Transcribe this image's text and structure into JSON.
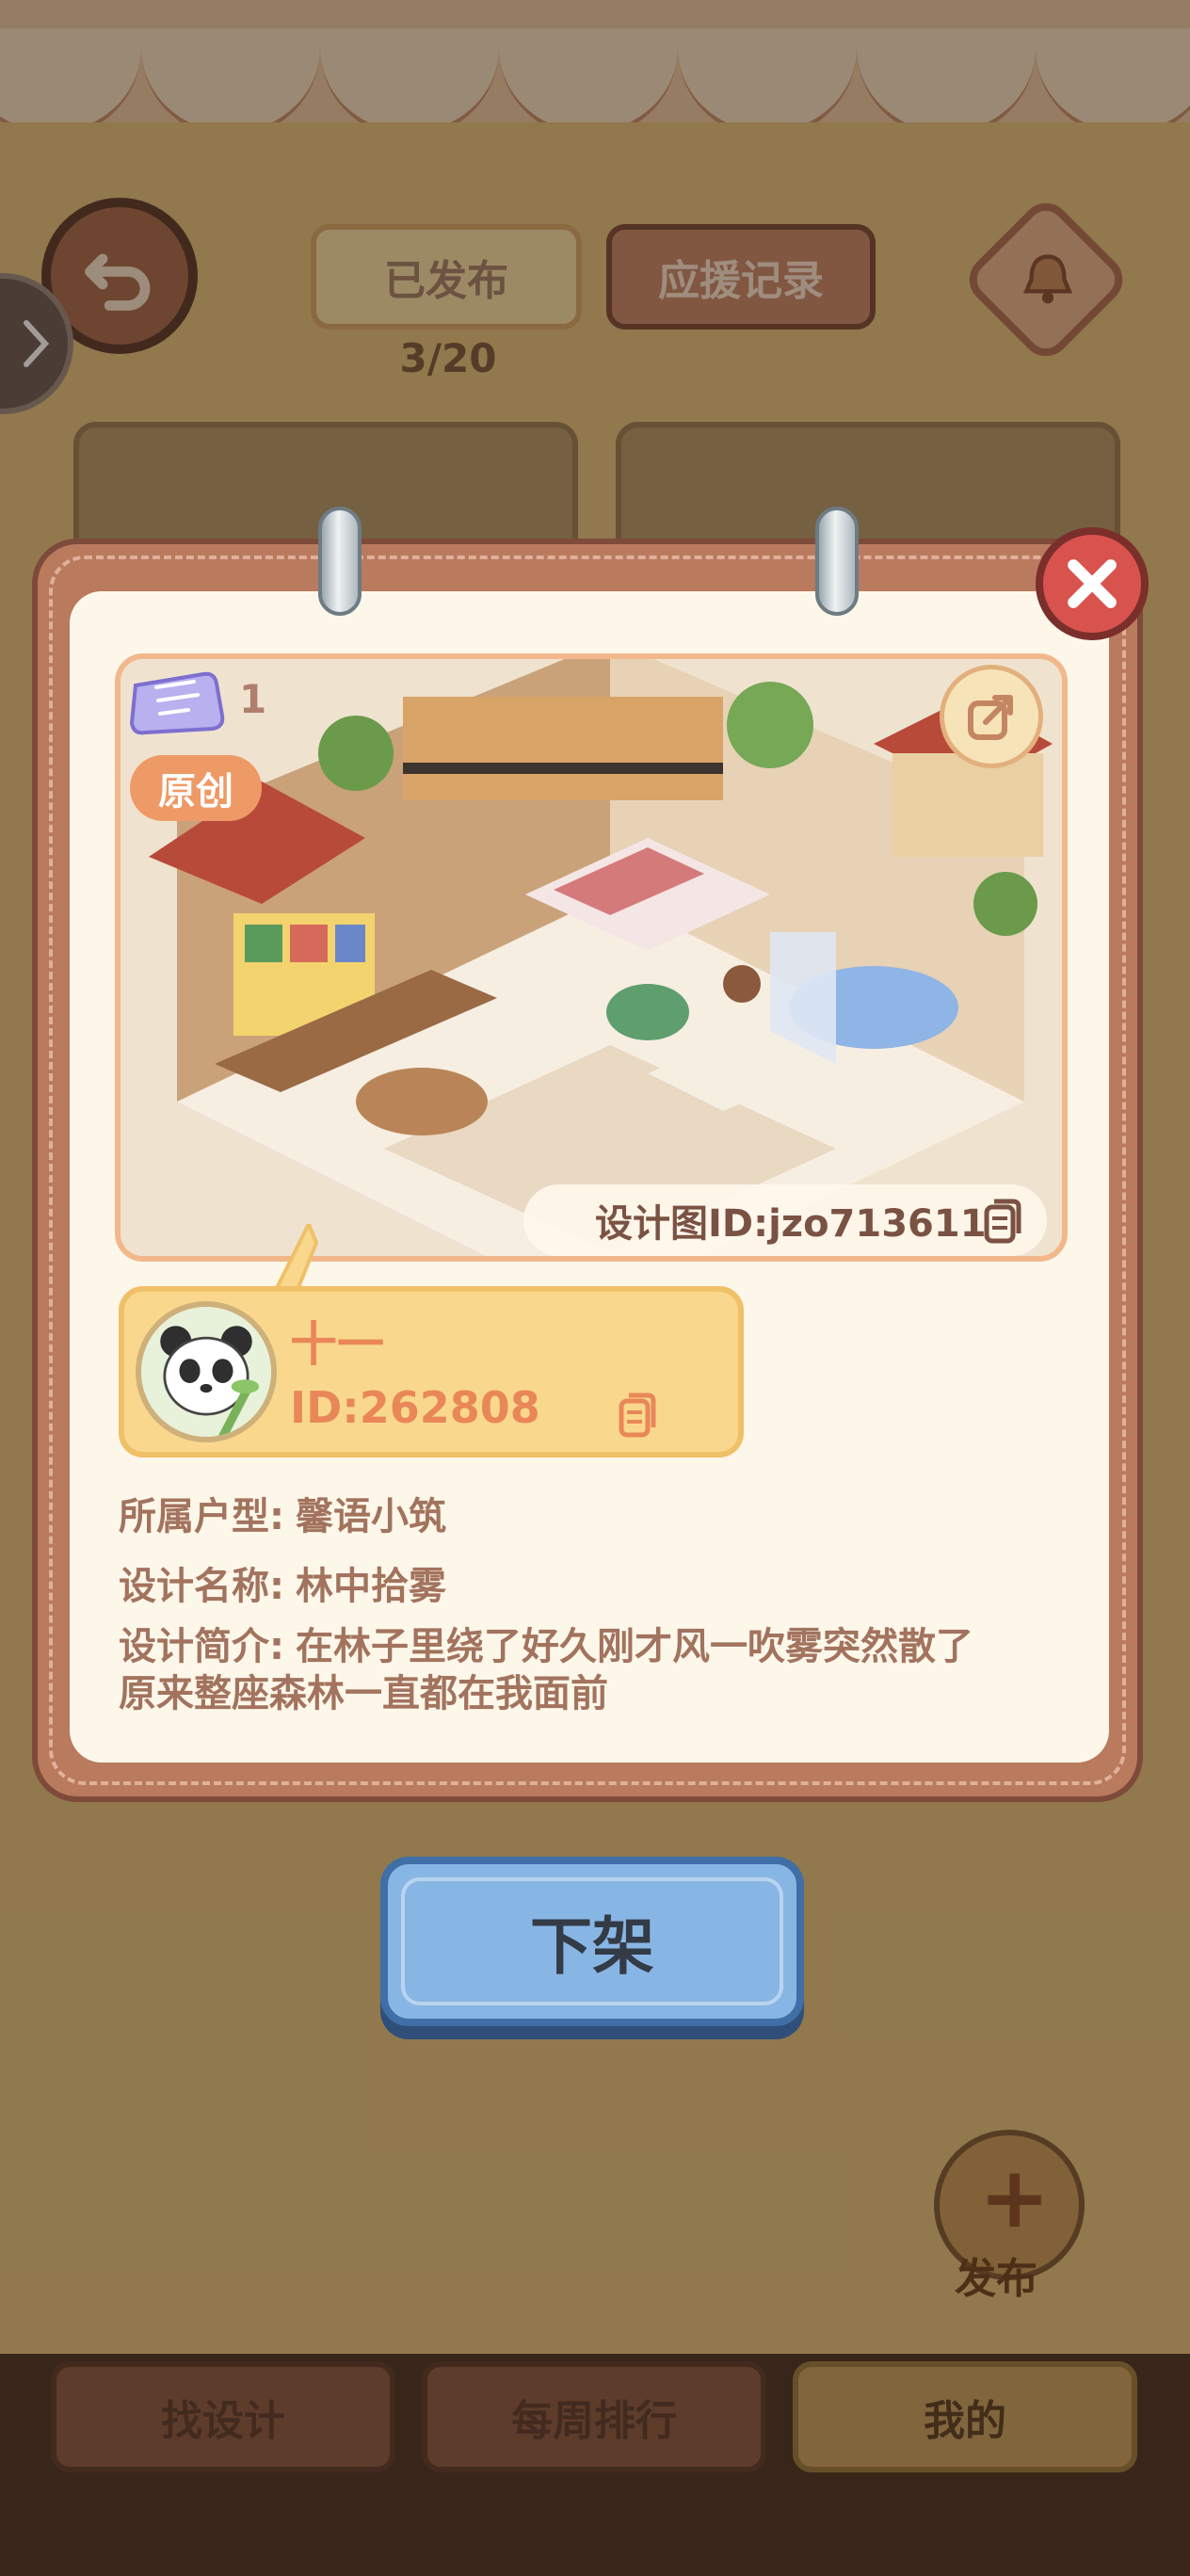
{
  "background": {
    "tabs": {
      "published": "已发布",
      "support_records": "应援记录"
    },
    "publish_count": "3/20",
    "bottom_nav": {
      "find_design": "找设计",
      "weekly_ranking": "每周排行",
      "mine": "我的"
    },
    "publish_label": "发布",
    "icons": [
      "back-icon",
      "chevron-right-icon",
      "bell-icon",
      "plus-icon"
    ]
  },
  "modal": {
    "likes_count": "1",
    "original_badge": "原创",
    "design_id": "设计图ID:jzo713611",
    "author": {
      "name": "十一",
      "id": "ID:262808"
    },
    "info": {
      "house_type_label": "所属户型:",
      "house_type": "馨语小筑",
      "design_name_label": "设计名称:",
      "design_name": "林中拾雾",
      "intro_label": "设计简介:",
      "intro_line1": "在林子里绕了好久刚才风一吹雾突然散了",
      "intro_line2": "原来整座森林一直都在我面前"
    },
    "delist_button": "下架",
    "icons": [
      "close-icon",
      "share-icon",
      "ticket-icon",
      "copy-icon",
      "panda-avatar"
    ]
  },
  "colors": {
    "modal_frame": "#b97a5e",
    "paper": "#fdf7ea",
    "accent_orange": "#e98758",
    "button_blue": "#88b6e4",
    "close_red": "#d9534e"
  }
}
